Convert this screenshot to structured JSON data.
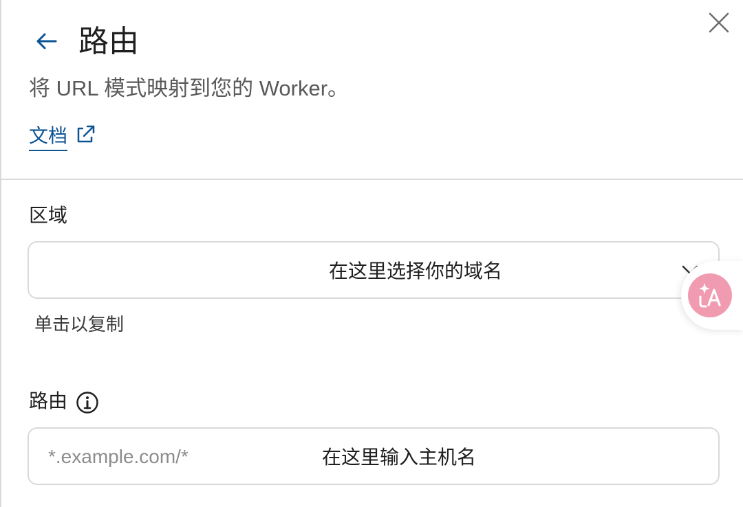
{
  "header": {
    "title": "路由",
    "subtitle": "将 URL 模式映射到您的 Worker。",
    "docs_link": "文档"
  },
  "zone": {
    "label": "区域",
    "select_value": "在这里选择你的域名",
    "hint": "单击以复制"
  },
  "route": {
    "label": "路由",
    "placeholder": "*.example.com/*",
    "overlay_hint": "在这里输入主机名"
  },
  "icons": {
    "back": "arrow-left-icon",
    "close": "close-icon",
    "external": "external-link-icon",
    "chevron": "chevron-down-icon",
    "info": "info-icon",
    "translate": "translate-icon"
  },
  "colors": {
    "link": "#0b5394",
    "border": "#d9d9d9",
    "translate_fab": "#f19bb1"
  }
}
